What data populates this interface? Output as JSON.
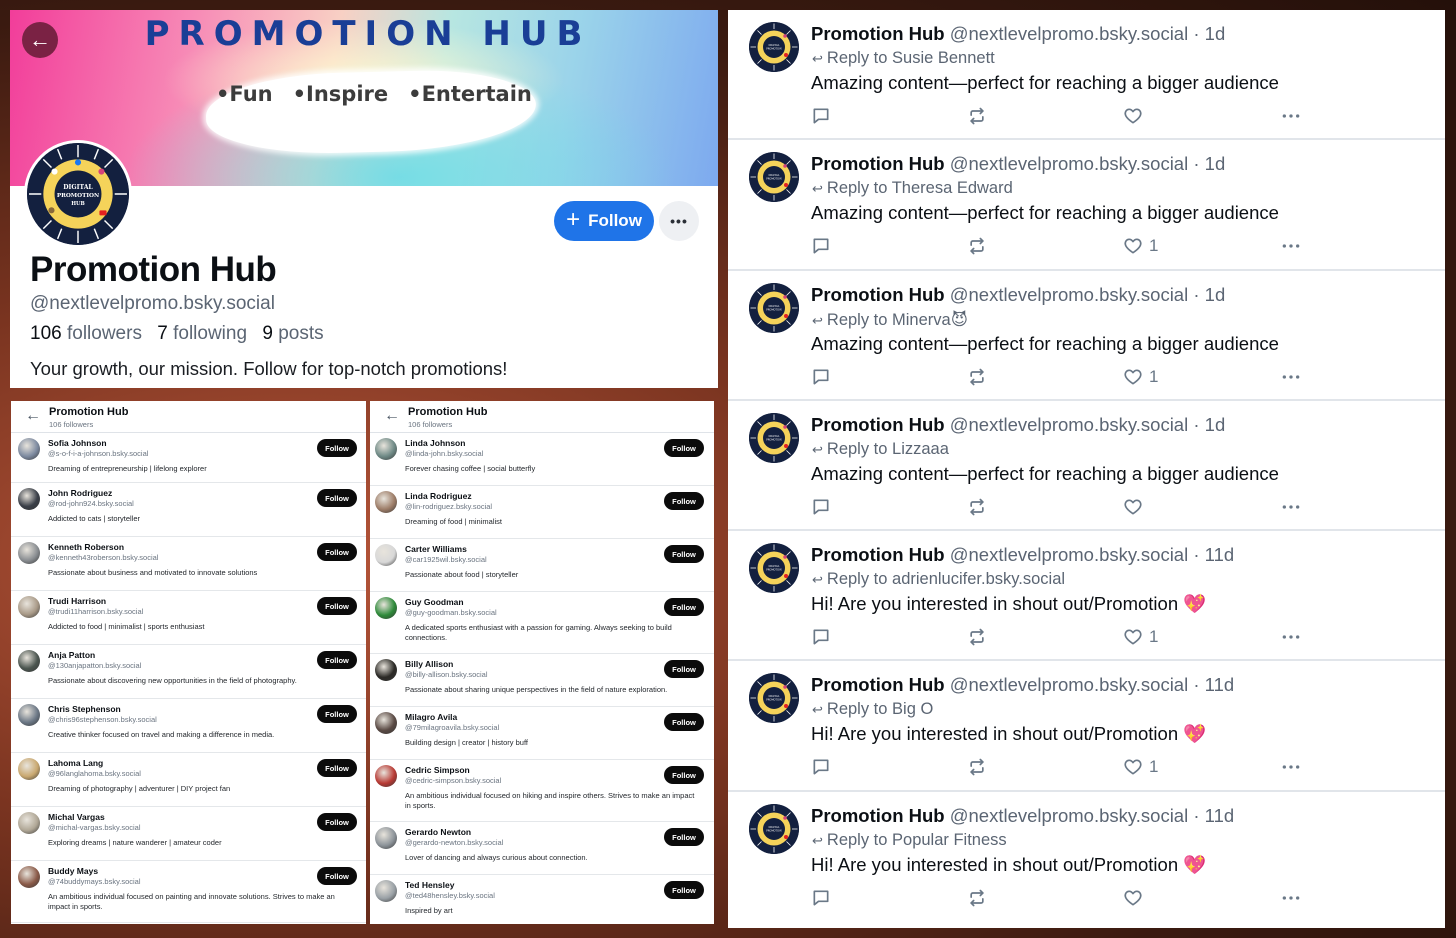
{
  "profile": {
    "banner_title": "PROMOTION HUB",
    "banner_tags": [
      "•Fun",
      "•Inspire",
      "•Entertain"
    ],
    "avatar_text": [
      "DIGITAL",
      "PROMOTION",
      "HUB"
    ],
    "back_icon": "arrow-left-icon",
    "follow_label": "Follow",
    "more_label": "•••",
    "display_name": "Promotion Hub",
    "handle": "@nextlevelpromo.bsky.social",
    "followers_count": "106",
    "followers_label": "followers",
    "following_count": "7",
    "following_label": "following",
    "posts_count": "9",
    "posts_label": "posts",
    "bio": "Your growth, our mission. Follow for top-notch promotions!"
  },
  "followers_lists": [
    {
      "title": "Promotion Hub",
      "subtitle": "106 followers",
      "items": [
        {
          "name": "Sofia Johnson",
          "handle": "@s-o-f-i-a-johnson.bsky.social",
          "bio": "Dreaming of entrepreneurship | lifelong explorer",
          "follow": "Follow",
          "avatar_color": "#7d8aa0"
        },
        {
          "name": "John Rodriguez",
          "handle": "@rod-john924.bsky.social",
          "bio": "Addicted to cats | storyteller",
          "follow": "Follow",
          "avatar_color": "#3a3f48"
        },
        {
          "name": "Kenneth Roberson",
          "handle": "@kenneth43roberson.bsky.social",
          "bio": "Passionate about business and motivated to innovate solutions",
          "follow": "Follow",
          "avatar_color": "#8a8e92"
        },
        {
          "name": "Trudi Harrison",
          "handle": "@trudi11harrison.bsky.social",
          "bio": "Addicted to food | minimalist | sports enthusiast",
          "follow": "Follow",
          "avatar_color": "#a99a88"
        },
        {
          "name": "Anja Patton",
          "handle": "@130anjapatton.bsky.social",
          "bio": "Passionate about discovering new opportunities in the field of photography.",
          "follow": "Follow",
          "avatar_color": "#4c5650"
        },
        {
          "name": "Chris Stephenson",
          "handle": "@chris96stephenson.bsky.social",
          "bio": "Creative thinker focused on travel and making a difference in media.",
          "follow": "Follow",
          "avatar_color": "#6c7886"
        },
        {
          "name": "Lahoma Lang",
          "handle": "@96langlahoma.bsky.social",
          "bio": "Dreaming of photography | adventurer | DIY project fan",
          "follow": "Follow",
          "avatar_color": "#c9a870"
        },
        {
          "name": "Michal Vargas",
          "handle": "@michal-vargas.bsky.social",
          "bio": "Exploring dreams | nature wanderer | amateur coder",
          "follow": "Follow",
          "avatar_color": "#b0a796"
        },
        {
          "name": "Buddy Mays",
          "handle": "@74buddymays.bsky.social",
          "bio": "An ambitious individual focused on painting and innovate solutions. Strives to make an impact in sports.",
          "follow": "Follow",
          "avatar_color": "#8a5a48"
        }
      ]
    },
    {
      "title": "Promotion Hub",
      "subtitle": "106 followers",
      "items": [
        {
          "name": "Linda Johnson",
          "handle": "@linda-john.bsky.social",
          "bio": "Forever chasing coffee | social butterfly",
          "follow": "Follow",
          "avatar_color": "#6f8a86"
        },
        {
          "name": "Linda Rodriguez",
          "handle": "@lin-rodriguez.bsky.social",
          "bio": "Dreaming of food | minimalist",
          "follow": "Follow",
          "avatar_color": "#9d7d68"
        },
        {
          "name": "Carter Williams",
          "handle": "@car1925wil.bsky.social",
          "bio": "Passionate about food | storyteller",
          "follow": "Follow",
          "avatar_color": "#d8d8d8"
        },
        {
          "name": "Guy Goodman",
          "handle": "@guy-goodman.bsky.social",
          "bio": "A dedicated sports enthusiast with a passion for gaming. Always seeking to build connections.",
          "follow": "Follow",
          "avatar_color": "#2e8a3a"
        },
        {
          "name": "Billy Allison",
          "handle": "@billy-allison.bsky.social",
          "bio": "Passionate about sharing unique perspectives in the field of nature exploration.",
          "follow": "Follow",
          "avatar_color": "#2b2a26"
        },
        {
          "name": "Milagro Avila",
          "handle": "@79milagroavila.bsky.social",
          "bio": "Building design | creator | history buff",
          "follow": "Follow",
          "avatar_color": "#5a4a44"
        },
        {
          "name": "Cedric Simpson",
          "handle": "@cedric-simpson.bsky.social",
          "bio": "An ambitious individual focused on hiking and inspire others. Strives to make an impact in sports.",
          "follow": "Follow",
          "avatar_color": "#b83a34"
        },
        {
          "name": "Gerardo Newton",
          "handle": "@gerardo-newton.bsky.social",
          "bio": "Lover of dancing and always curious about connection.",
          "follow": "Follow",
          "avatar_color": "#8d949a"
        },
        {
          "name": "Ted Hensley",
          "handle": "@ted48hensley.bsky.social",
          "bio": "Inspired by art",
          "follow": "Follow",
          "avatar_color": "#9aa1a6"
        }
      ]
    }
  ],
  "posts": [
    {
      "name": "Promotion Hub",
      "meta": "@nextlevelpromo.bsky.social · 1d",
      "reply_to": "Reply to Susie Bennett",
      "text": "Amazing content—perfect for reaching a bigger audience",
      "likes": ""
    },
    {
      "name": "Promotion Hub",
      "meta": "@nextlevelpromo.bsky.social · 1d",
      "reply_to": "Reply to Theresa Edward",
      "text": "Amazing content—perfect for reaching a bigger audience",
      "likes": "1"
    },
    {
      "name": "Promotion Hub",
      "meta": "@nextlevelpromo.bsky.social · 1d",
      "reply_to": "Reply to Minerva😈",
      "text": "Amazing content—perfect for reaching a bigger audience",
      "likes": "1"
    },
    {
      "name": "Promotion Hub",
      "meta": "@nextlevelpromo.bsky.social · 1d",
      "reply_to": "Reply to Lizzaaa",
      "text": "Amazing content—perfect for reaching a bigger audience",
      "likes": ""
    },
    {
      "name": "Promotion Hub",
      "meta": "@nextlevelpromo.bsky.social · 11d",
      "reply_to": "Reply to adrienlucifer.bsky.social",
      "text": "Hi! Are you interested in shout out/Promotion 💖",
      "likes": "1"
    },
    {
      "name": "Promotion Hub",
      "meta": "@nextlevelpromo.bsky.social · 11d",
      "reply_to": "Reply to Big O",
      "text": "Hi! Are you interested in shout out/Promotion 💖",
      "likes": "1"
    },
    {
      "name": "Promotion Hub",
      "meta": "@nextlevelpromo.bsky.social · 11d",
      "reply_to": "Reply to Popular Fitness",
      "text": "Hi! Are you interested in shout out/Promotion 💖",
      "likes": ""
    }
  ],
  "icons": {
    "reply": "reply-arrow-icon",
    "comment": "comment-bubble-icon",
    "repost": "repost-icon",
    "like": "heart-icon",
    "more": "more-dots-icon"
  },
  "colors": {
    "follow_blue": "#1f74e8",
    "follow_black": "#0b0b0b",
    "banner_title": "#1a3e96",
    "muted_text": "#5b6573"
  }
}
